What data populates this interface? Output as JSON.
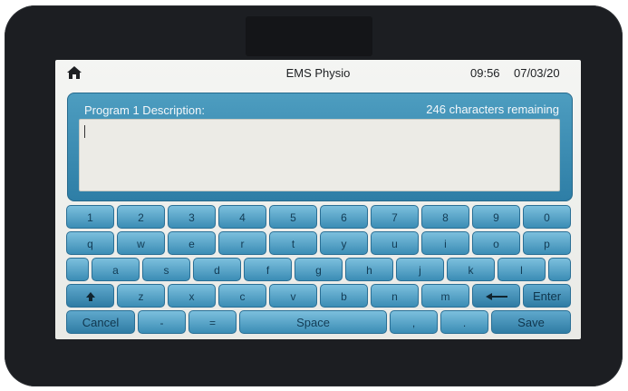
{
  "header": {
    "title": "EMS Physio",
    "time": "09:56",
    "date": "07/03/20",
    "home_icon": "home-icon"
  },
  "description": {
    "label": "Program 1 Description:",
    "remaining": "246 characters remaining",
    "value": ""
  },
  "keyboard": {
    "row1": [
      "1",
      "2",
      "3",
      "4",
      "5",
      "6",
      "7",
      "8",
      "9",
      "0"
    ],
    "row2": [
      "q",
      "w",
      "e",
      "r",
      "t",
      "y",
      "u",
      "i",
      "o",
      "p"
    ],
    "row3": [
      "a",
      "s",
      "d",
      "f",
      "g",
      "h",
      "j",
      "k",
      "l"
    ],
    "row4": [
      "z",
      "x",
      "c",
      "v",
      "b",
      "n",
      "m"
    ],
    "enter_label": "Enter",
    "cancel_label": "Cancel",
    "minus_label": "-",
    "equals_label": "=",
    "space_label": "Space",
    "comma_label": ",",
    "period_label": ".",
    "save_label": "Save",
    "shift_icon": "shift-arrow-icon",
    "backspace_icon": "backspace-arrow-icon"
  },
  "colors": {
    "panel": "#3a88b0",
    "key": "#5aa6cc",
    "bezel": "#1c1e22"
  }
}
